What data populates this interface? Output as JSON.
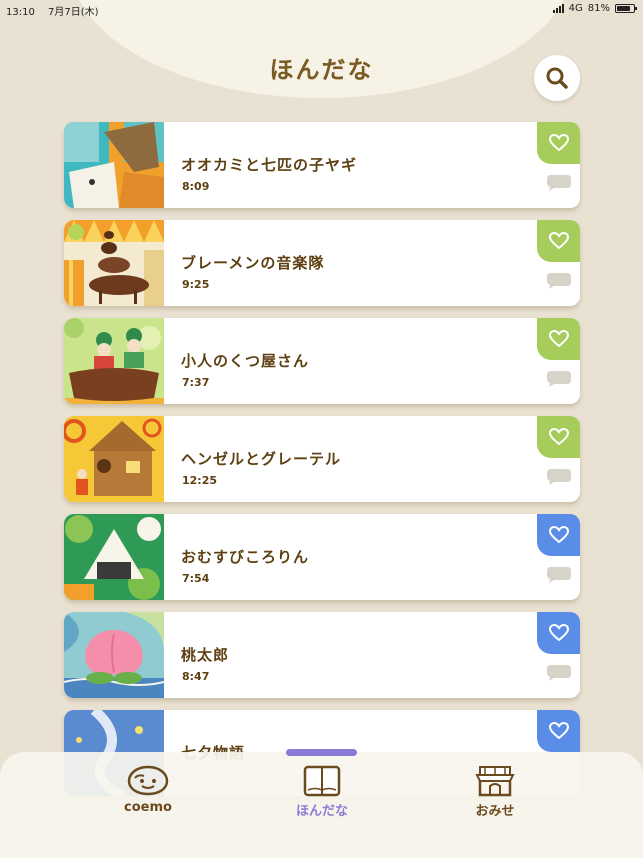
{
  "status_bar": {
    "time": "13:10",
    "date": "7月7日(木)",
    "network": "4G",
    "battery": "81%"
  },
  "header": {
    "title": "ほんだな",
    "search_icon": "search-icon"
  },
  "books": [
    {
      "title": "オオカミと七匹の子ヤギ",
      "duration": "8:09",
      "favorite_color": "#a6cd5b",
      "cover": "wolf-goat-cover"
    },
    {
      "title": "ブレーメンの音楽隊",
      "duration": "9:25",
      "favorite_color": "#a6cd5b",
      "cover": "bremen-musicians-cover"
    },
    {
      "title": "小人のくつ屋さん",
      "duration": "7:37",
      "favorite_color": "#a6cd5b",
      "cover": "elves-shoemaker-cover"
    },
    {
      "title": "ヘンゼルとグレーテル",
      "duration": "12:25",
      "favorite_color": "#a6cd5b",
      "cover": "hansel-gretel-cover"
    },
    {
      "title": "おむすびころりん",
      "duration": "7:54",
      "favorite_color": "#5a8de8",
      "cover": "rice-ball-cover"
    },
    {
      "title": "桃太郎",
      "duration": "8:47",
      "favorite_color": "#5a8de8",
      "cover": "momotaro-cover"
    },
    {
      "title": "七夕物語",
      "duration": "",
      "favorite_color": "#5a8de8",
      "cover": "tanabata-cover"
    }
  ],
  "nav": {
    "items": [
      {
        "label": "coemo",
        "icon": "coemo-face-icon"
      },
      {
        "label": "ほんだな",
        "icon": "book-icon",
        "active": true
      },
      {
        "label": "おみせ",
        "icon": "shop-icon"
      }
    ],
    "active_color": "#8a7bd9"
  }
}
